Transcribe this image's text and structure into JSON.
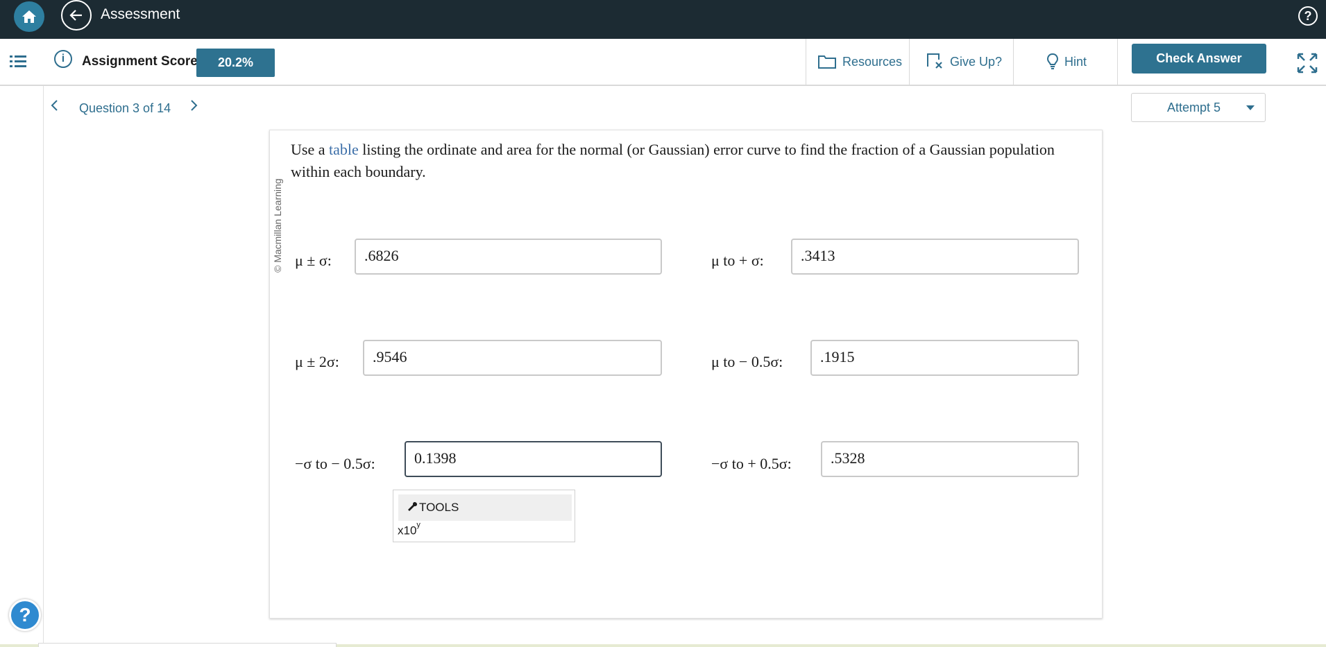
{
  "app": {
    "title": "Assessment"
  },
  "toolbar": {
    "score_label": "Assignment Score:",
    "score_value": "20.2%",
    "resources_label": "Resources",
    "giveup_label": "Give Up?",
    "hint_label": "Hint",
    "check_label": "Check Answer"
  },
  "nav": {
    "question_label": "Question 3 of 14",
    "attempt_label": "Attempt 5"
  },
  "question": {
    "copyright": "© Macmillan Learning",
    "prompt_before": "Use a ",
    "prompt_link": "table",
    "prompt_after": " listing the ordinate and area for the normal (or Gaussian) error curve to find the fraction of a Gaussian population within each boundary.",
    "rows": [
      {
        "label": "μ ± σ:",
        "value": ".6826"
      },
      {
        "label": "μ to  + σ:",
        "value": ".3413"
      },
      {
        "label": "μ ± 2σ:",
        "value": ".9546"
      },
      {
        "label": "μ to  − 0.5σ:",
        "value": ".1915"
      },
      {
        "label": "−σ to  − 0.5σ:",
        "value": "0.1398"
      },
      {
        "label": "−σ to  + 0.5σ:",
        "value": ".5328"
      }
    ]
  },
  "tools": {
    "label": "TOOLS",
    "x10": "x10",
    "x10_sup": "y"
  },
  "help": {
    "symbol": "?"
  },
  "colors": {
    "topbar": "#1c2b33",
    "accent": "#2e7290",
    "link": "#2e6e8e"
  }
}
